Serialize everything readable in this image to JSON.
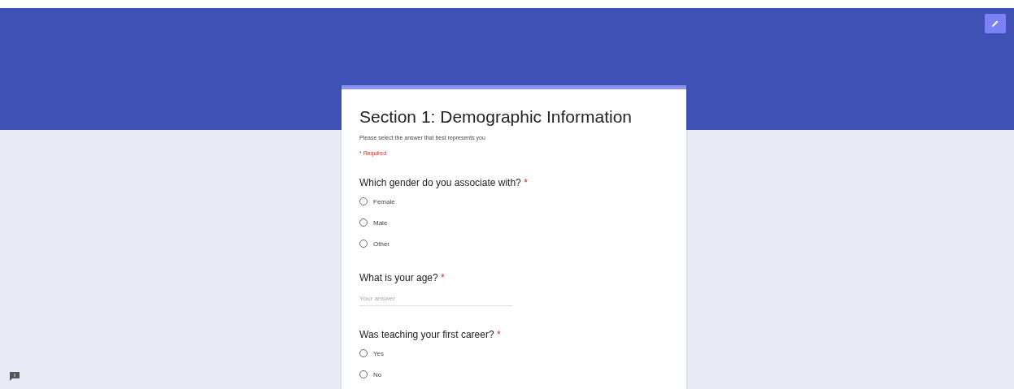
{
  "form": {
    "title": "Section 1: Demographic Information",
    "description": "Please select the answer that best represents you",
    "required_note": "* Required"
  },
  "questions": [
    {
      "kind": "radio",
      "text": "Which gender do you associate with?",
      "required_mark": "*",
      "options": [
        {
          "label": "Female",
          "selected": false
        },
        {
          "label": "Male",
          "selected": false
        },
        {
          "label": "Other",
          "selected": false
        }
      ]
    },
    {
      "kind": "text",
      "text": "What is your age?",
      "required_mark": "*",
      "placeholder": "Your answer"
    },
    {
      "kind": "radio",
      "text": "Was teaching your first career?",
      "required_mark": "*",
      "options": [
        {
          "label": "Yes",
          "selected": false
        },
        {
          "label": "No",
          "selected": false
        }
      ]
    }
  ]
}
